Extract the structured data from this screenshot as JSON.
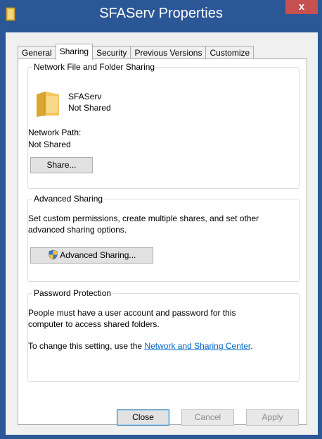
{
  "window": {
    "title": "SFAServ Properties",
    "close_glyph": "x",
    "titlebar_color": "#2b5797",
    "close_color": "#c75050"
  },
  "tabs": [
    {
      "label": "General",
      "active": false
    },
    {
      "label": "Sharing",
      "active": true
    },
    {
      "label": "Security",
      "active": false
    },
    {
      "label": "Previous Versions",
      "active": false
    },
    {
      "label": "Customize",
      "active": false
    }
  ],
  "network_sharing": {
    "legend": "Network File and Folder Sharing",
    "folder_name": "SFAServ",
    "folder_status": "Not Shared",
    "path_label": "Network Path:",
    "path_value": "Not Shared",
    "share_button": "Share..."
  },
  "advanced_sharing": {
    "legend": "Advanced Sharing",
    "description_line1": "Set custom permissions, create multiple shares, and set other",
    "description_line2": "advanced sharing options.",
    "button": "Advanced Sharing...",
    "button_icon": "uac-shield-icon"
  },
  "password_protection": {
    "legend": "Password Protection",
    "line1": "People must have a user account and password for this",
    "line2": "computer to access shared folders.",
    "change_prefix": "To change this setting, use the ",
    "link_text": "Network and Sharing Center",
    "change_suffix": "."
  },
  "footer": {
    "close": "Close",
    "cancel": "Cancel",
    "apply": "Apply"
  },
  "colors": {
    "link": "#0066cc",
    "panel_bg": "#ffffff",
    "dialog_bg": "#f0f0f0"
  }
}
